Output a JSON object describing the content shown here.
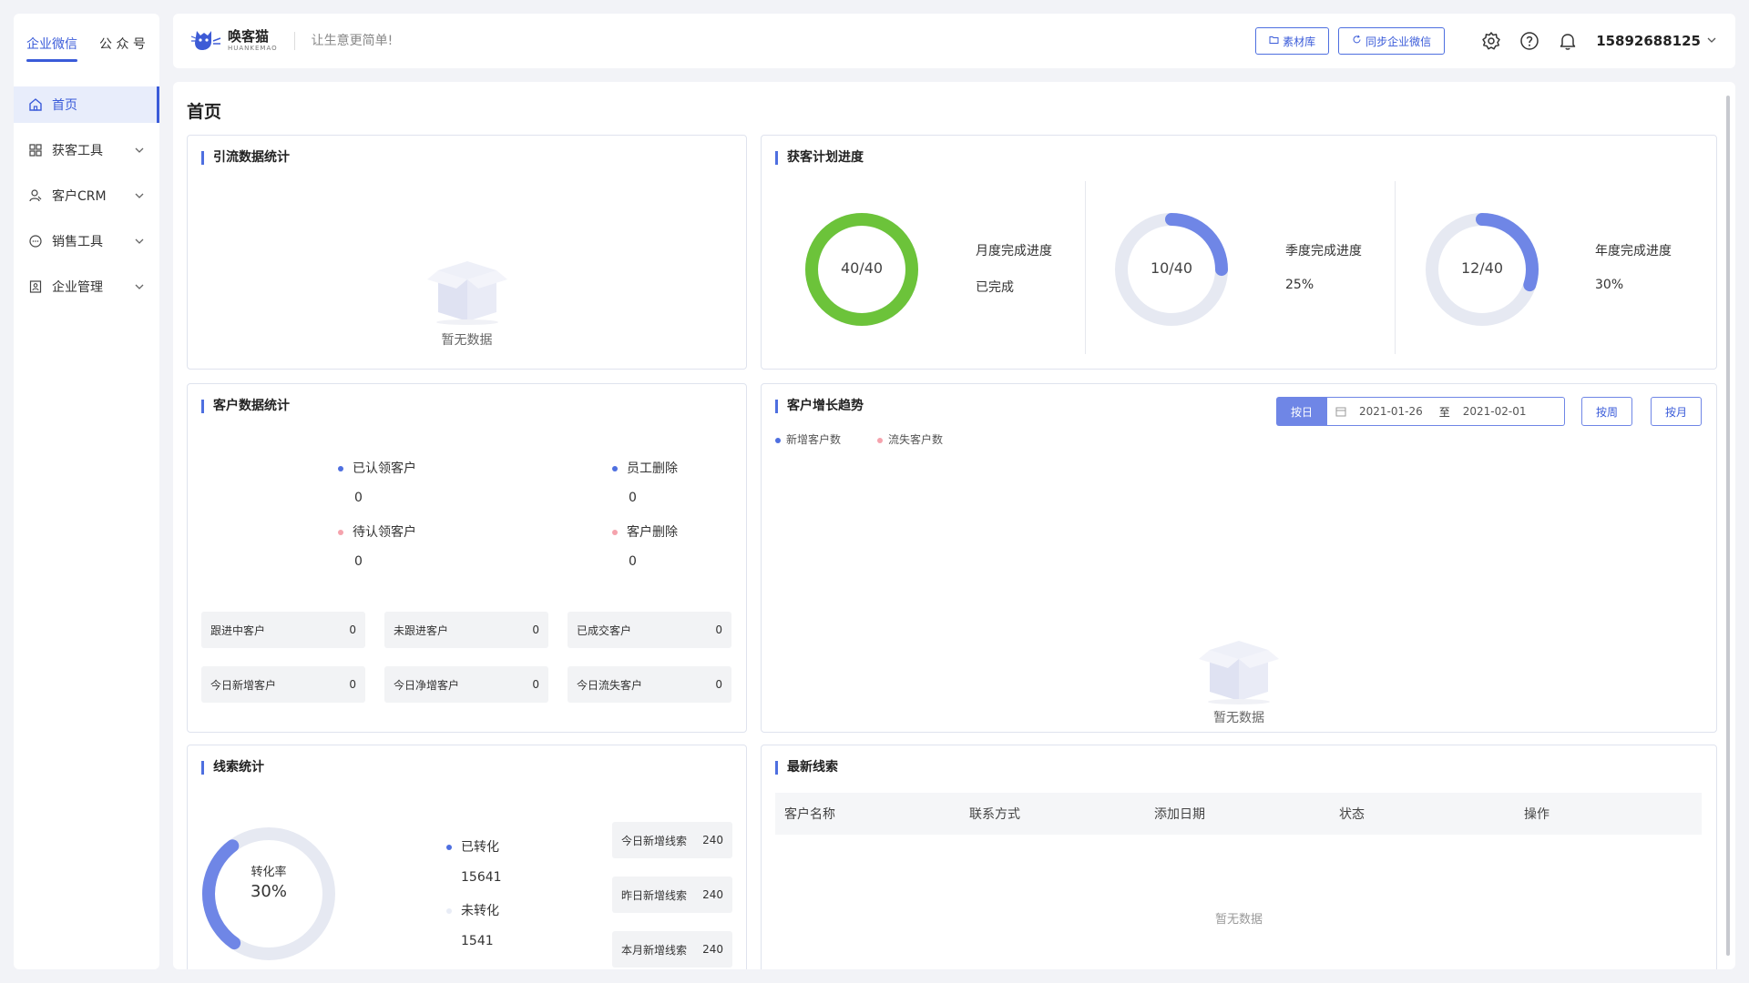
{
  "sidebar": {
    "tabs": [
      "企业微信",
      "公 众 号"
    ],
    "items": [
      {
        "label": "首页",
        "icon": "home-icon"
      },
      {
        "label": "获客工具",
        "icon": "grid-icon"
      },
      {
        "label": "客户CRM",
        "icon": "user-icon"
      },
      {
        "label": "销售工具",
        "icon": "chat-icon"
      },
      {
        "label": "企业管理",
        "icon": "building-icon"
      }
    ]
  },
  "header": {
    "logo_name": "唤客猫",
    "logo_sub": "HUANKEMAO",
    "slogan": "让生意更简单!",
    "btn_material": "素材库",
    "btn_sync": "同步企业微信",
    "user": "15892688125"
  },
  "page": {
    "title": "首页"
  },
  "traffic": {
    "title": "引流数据统计",
    "empty": "暂无数据"
  },
  "plan": {
    "title": "获客计划进度",
    "items": [
      {
        "value": "40/40",
        "label": "月度完成进度",
        "status": "已完成",
        "progress": 1.0,
        "color": "#6cc33a"
      },
      {
        "value": "10/40",
        "label": "季度完成进度",
        "status": "25%",
        "progress": 0.25,
        "color": "#6f86e6"
      },
      {
        "value": "12/40",
        "label": "年度完成进度",
        "status": "30%",
        "progress": 0.3,
        "color": "#6f86e6"
      }
    ]
  },
  "customer": {
    "title": "客户数据统计",
    "stats": [
      {
        "label": "已认领客户",
        "value": "0",
        "color": "#4e6fe0"
      },
      {
        "label": "员工删除",
        "value": "0",
        "color": "#4e6fe0"
      },
      {
        "label": "待认领客户",
        "value": "0",
        "color": "#f5a3ad"
      },
      {
        "label": "客户删除",
        "value": "0",
        "color": "#f5a3ad"
      }
    ],
    "pills": [
      {
        "label": "跟进中客户",
        "value": "0"
      },
      {
        "label": "未跟进客户",
        "value": "0"
      },
      {
        "label": "已成交客户",
        "value": "0"
      },
      {
        "label": "今日新增客户",
        "value": "0"
      },
      {
        "label": "今日净增客户",
        "value": "0"
      },
      {
        "label": "今日流失客户",
        "value": "0"
      }
    ]
  },
  "growth": {
    "title": "客户增长趋势",
    "by_day": "按日",
    "date_from": "2021-01-26",
    "date_sep": "至",
    "date_to": "2021-02-01",
    "by_week": "按周",
    "by_month": "按月",
    "legend": [
      {
        "label": "新增客户数",
        "color": "#4e6fe0"
      },
      {
        "label": "流失客户数",
        "color": "#f5a3ad"
      }
    ],
    "empty": "暂无数据"
  },
  "leads": {
    "title": "线索统计",
    "rate_label": "转化率",
    "rate_value": "30%",
    "rate": 0.3,
    "stats": [
      {
        "label": "已转化",
        "value": "15641",
        "color": "#4e6fe0"
      },
      {
        "label": "未转化",
        "value": "1541",
        "color": "#e8ecf6"
      }
    ],
    "pills": [
      {
        "label": "今日新增线索",
        "value": "240"
      },
      {
        "label": "昨日新增线索",
        "value": "240"
      },
      {
        "label": "本月新增线索",
        "value": "240"
      }
    ]
  },
  "latest": {
    "title": "最新线索",
    "columns": [
      "客户名称",
      "联系方式",
      "添加日期",
      "状态",
      "操作"
    ],
    "empty": "暂无数据"
  }
}
